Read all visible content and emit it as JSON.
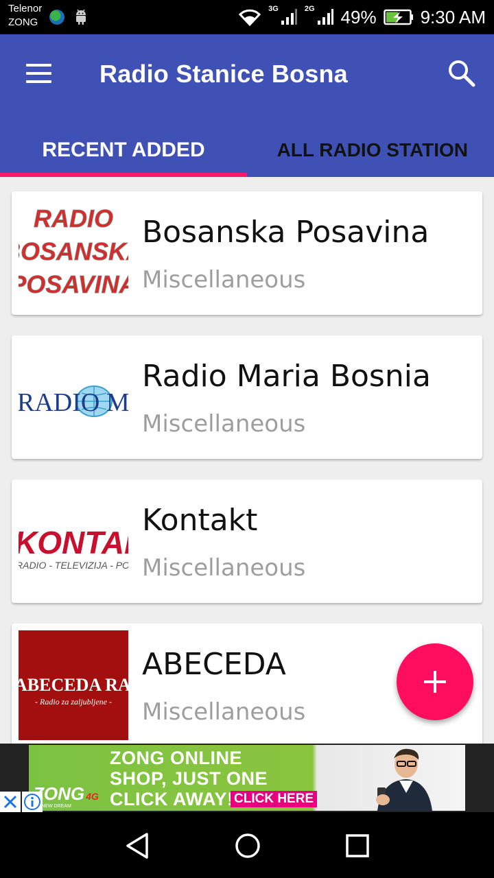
{
  "status_bar": {
    "carrier_line1": "Telenor",
    "carrier_line2": "ZONG",
    "network_3g": "3G",
    "network_2g": "2G",
    "battery_percent": "49%",
    "time": "9:30 AM"
  },
  "app_bar": {
    "title": "Radio Stanice Bosna",
    "menu_icon": "hamburger-menu-icon",
    "search_icon": "search-icon"
  },
  "tabs": [
    {
      "label": "RECENT ADDED",
      "selected": true
    },
    {
      "label": "ALL RADIO STATION",
      "selected": false
    }
  ],
  "stations": [
    {
      "name": "Bosanska Posavina",
      "category": "Miscellaneous",
      "logo_text": [
        "RADIO",
        "BOSANSKA",
        "POSAVINA"
      ]
    },
    {
      "name": "Radio Maria Bosnia",
      "category": "Miscellaneous",
      "logo_text": [
        "RADIO MARIA"
      ]
    },
    {
      "name": "Kontakt",
      "category": "Miscellaneous",
      "logo_text": [
        "KONTAKT",
        "RADIO - TELEVIZIJA - POSAVINA"
      ]
    },
    {
      "name": "ABECEDA",
      "category": "Miscellaneous",
      "logo_text": [
        "ABECEDA RADIO",
        "- Radio za zaljubljene -"
      ]
    }
  ],
  "fab": {
    "icon": "plus-icon"
  },
  "ad": {
    "line1": "ZONG ONLINE",
    "line2": "SHOP, JUST ONE",
    "line3": "CLICK AWAY!",
    "cta": "CLICK HERE",
    "brand": "ZONG",
    "brand_suffix": "4G",
    "tagline": "A NEW DREAM"
  },
  "colors": {
    "primary": "#3f51b5",
    "accent": "#ff1a6c",
    "fab": "#ff0d5e"
  }
}
